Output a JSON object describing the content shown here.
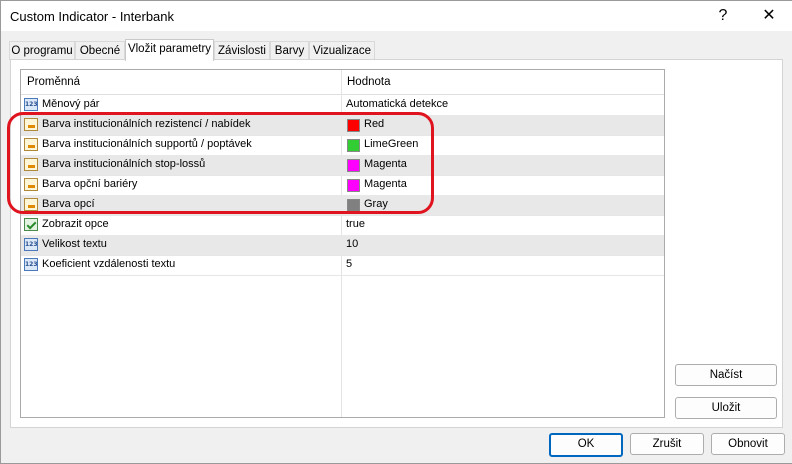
{
  "window": {
    "title": "Custom Indicator - Interbank",
    "help_glyph": "?",
    "close_glyph": "✕"
  },
  "tabs": [
    {
      "label": "O programu",
      "active": false
    },
    {
      "label": "Obecné",
      "active": false
    },
    {
      "label": "Vložit parametry",
      "active": true
    },
    {
      "label": "Závislosti",
      "active": false
    },
    {
      "label": "Barvy",
      "active": false
    },
    {
      "label": "Vizualizace",
      "active": false
    }
  ],
  "grid": {
    "headers": {
      "name": "Proměnná",
      "value": "Hodnota"
    },
    "rows": [
      {
        "type": "number",
        "icon": "number-param-icon",
        "name": "Měnový pár",
        "value": "Automatická detekce"
      },
      {
        "type": "color",
        "icon": "color-param-icon",
        "name": "Barva institucionálních rezistencí / nabídek",
        "value": "Red",
        "color": "#ff0000"
      },
      {
        "type": "color",
        "icon": "color-param-icon",
        "name": "Barva institucionálních supportů / poptávek",
        "value": "LimeGreen",
        "color": "#32cd32"
      },
      {
        "type": "color",
        "icon": "color-param-icon",
        "name": "Barva institucionálních stop-lossů",
        "value": "Magenta",
        "color": "#ff00ff"
      },
      {
        "type": "color",
        "icon": "color-param-icon",
        "name": "Barva opční bariéry",
        "value": "Magenta",
        "color": "#ff00ff"
      },
      {
        "type": "color",
        "icon": "color-param-icon",
        "name": "Barva opcí",
        "value": "Gray",
        "color": "#808080"
      },
      {
        "type": "bool",
        "icon": "bool-param-icon",
        "name": "Zobrazit opce",
        "value": "true"
      },
      {
        "type": "number",
        "icon": "number-param-icon",
        "name": "Velikost textu",
        "value": "10"
      },
      {
        "type": "number",
        "icon": "number-param-icon",
        "name": "Koeficient vzdálenosti textu",
        "value": "5"
      }
    ],
    "number_icon_text": "123"
  },
  "side_buttons": {
    "load": "Načíst",
    "save": "Uložit"
  },
  "footer": {
    "ok": "OK",
    "cancel": "Zrušit",
    "reset": "Obnovit"
  },
  "colors": {
    "highlight": "#e0141f",
    "accent": "#0067c0"
  }
}
